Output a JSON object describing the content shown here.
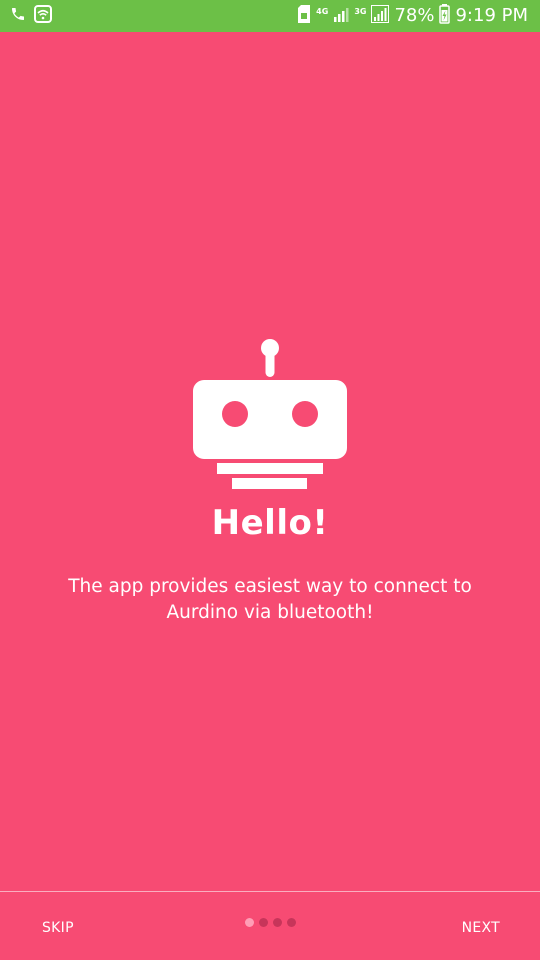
{
  "status_bar": {
    "net_4g": "4G",
    "net_3g": "3G",
    "battery": "78%",
    "time": "9:19 PM",
    "icons": [
      "phone-icon",
      "wifi-icon",
      "sim-icon",
      "signal-icon",
      "signal-icon",
      "battery-icon"
    ],
    "background_color": "#6CC047"
  },
  "onboarding": {
    "background_color": "#F74B73",
    "hero_icon": "robot-icon",
    "title": "Hello!",
    "description": "The app provides easiest way to connect to Aurdino via bluetooth!"
  },
  "footer": {
    "skip_label": "SKIP",
    "next_label": "NEXT",
    "page_count": 4,
    "current_page": 1
  }
}
